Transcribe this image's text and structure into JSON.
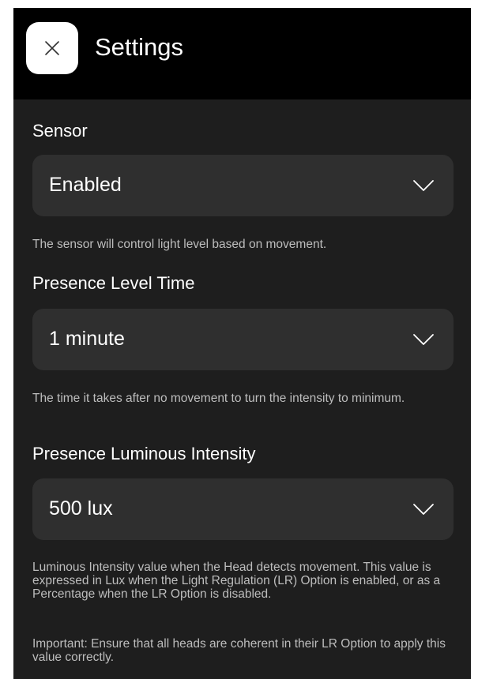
{
  "header": {
    "title": "Settings",
    "close_icon": "close-icon"
  },
  "colors": {
    "header_bg": "#000000",
    "page_bg": "#1e1e1e",
    "field_bg": "#2f2f2f",
    "text": "#ffffff",
    "helper_text": "#bdbdbd"
  },
  "sensor": {
    "label": "Sensor",
    "value": "Enabled",
    "helper": "The sensor will control light level based on movement."
  },
  "presence_level_time": {
    "label": "Presence Level Time",
    "value": "1 minute",
    "helper": "The time it takes after no movement to turn the intensity to minimum."
  },
  "presence_luminous_intensity": {
    "label": "Presence Luminous Intensity",
    "value": "500 lux",
    "helper": "Luminous Intensity value when the Head detects movement. This value is expressed in Lux when the Light Regulation (LR) Option is enabled, or as a Percentage when the LR Option is disabled.",
    "important": "Important: Ensure that all heads are coherent in their LR Option to apply this value correctly."
  }
}
